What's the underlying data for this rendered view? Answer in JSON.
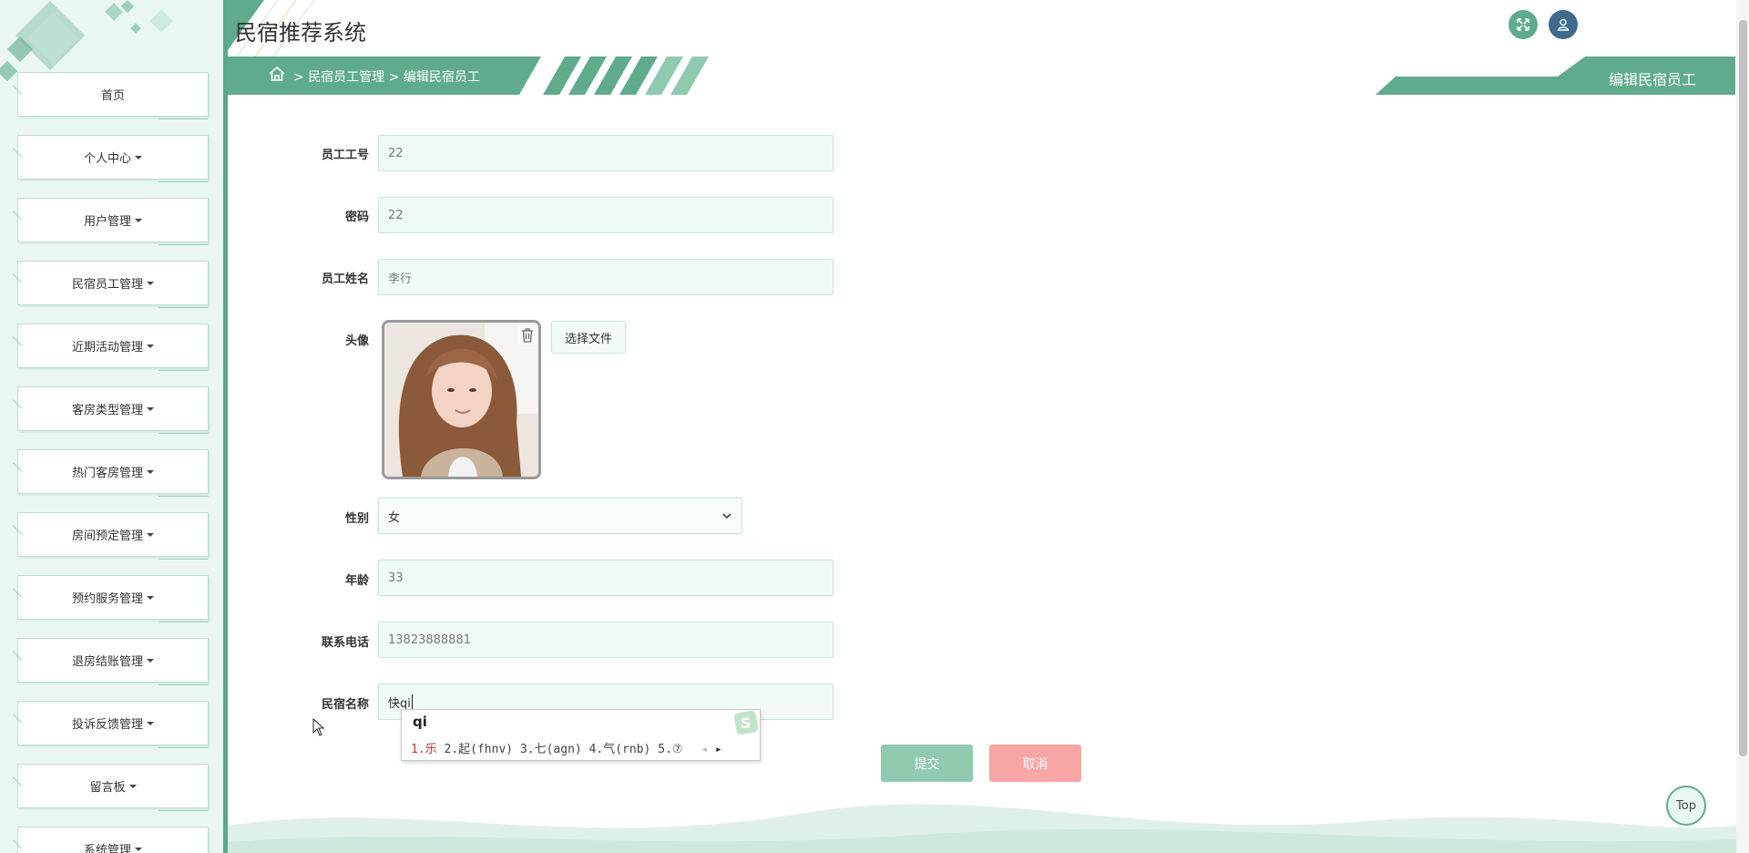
{
  "app": {
    "title": "民宿推荐系统"
  },
  "sidebar": {
    "items": [
      {
        "label": "首页",
        "has_caret": false
      },
      {
        "label": "个人中心",
        "has_caret": true
      },
      {
        "label": "用户管理",
        "has_caret": true
      },
      {
        "label": "民宿员工管理",
        "has_caret": true
      },
      {
        "label": "近期活动管理",
        "has_caret": true
      },
      {
        "label": "客房类型管理",
        "has_caret": true
      },
      {
        "label": "热门客房管理",
        "has_caret": true
      },
      {
        "label": "房间预定管理",
        "has_caret": true
      },
      {
        "label": "预约服务管理",
        "has_caret": true
      },
      {
        "label": "退房结账管理",
        "has_caret": true
      },
      {
        "label": "投诉反馈管理",
        "has_caret": true
      },
      {
        "label": "留言板",
        "has_caret": true
      },
      {
        "label": "系统管理",
        "has_caret": true
      }
    ]
  },
  "breadcrumb": {
    "sep": ">",
    "section": "民宿员工管理",
    "page": "编辑民宿员工"
  },
  "page_tag": "编辑民宿员工",
  "form": {
    "employee_id": {
      "label": "员工工号",
      "value": "22"
    },
    "password": {
      "label": "密码",
      "value": "22"
    },
    "name": {
      "label": "员工姓名",
      "value": "李行"
    },
    "avatar": {
      "label": "头像",
      "choose_label": "选择文件"
    },
    "gender": {
      "label": "性别",
      "value": "女"
    },
    "age": {
      "label": "年龄",
      "value": "33"
    },
    "phone": {
      "label": "联系电话",
      "value": "13823888881"
    },
    "homestay": {
      "label": "民宿名称",
      "value": "快qi"
    }
  },
  "ime": {
    "input": "qi",
    "candidates": [
      {
        "index": "1.",
        "text": "乐"
      },
      {
        "index": "2.",
        "text": "起(fhnv)"
      },
      {
        "index": "3.",
        "text": "七(agn)"
      },
      {
        "index": "4.",
        "text": "气(rnb)"
      },
      {
        "index": "5.",
        "text": "⑦"
      }
    ]
  },
  "buttons": {
    "submit": "提交",
    "cancel": "取消",
    "top": "Top"
  },
  "colors": {
    "primary": "#5fab8c",
    "sidebar_bg": "#eaf7f1",
    "submit_bg": "#8fc9ae",
    "cancel_bg": "#f7a5a5",
    "header_btn_1": "#5fab8c",
    "header_btn_2": "#3e6a8c"
  },
  "icons": {
    "fullscreen": "expand-icon",
    "user": "user-icon",
    "home": "home-icon",
    "delete": "trash-icon",
    "select": "chevron-down-icon"
  }
}
